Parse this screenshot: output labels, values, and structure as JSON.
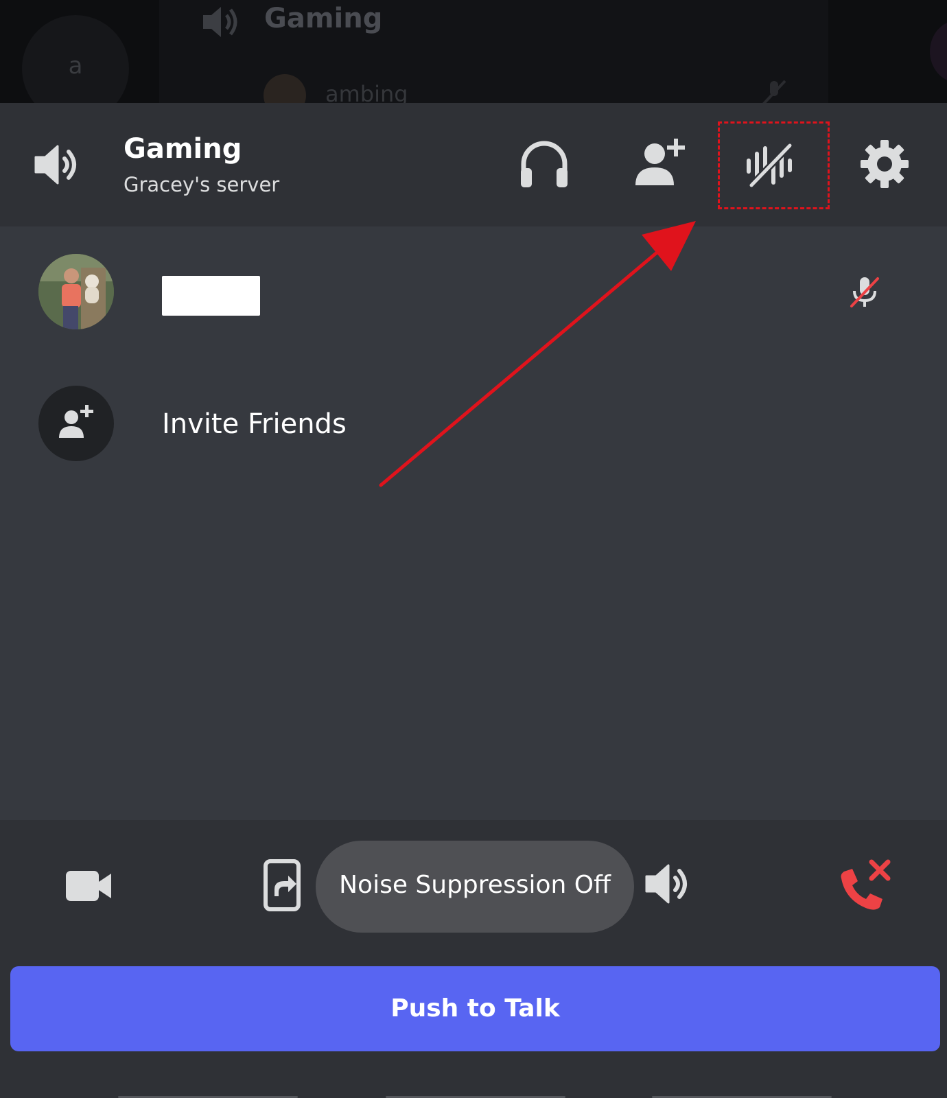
{
  "background": {
    "server_initial": "a",
    "channel_title": "Gaming",
    "user_name": "ambing"
  },
  "header": {
    "channel_title": "Gaming",
    "server_name": "Gracey's server",
    "icons": [
      "speaker-icon",
      "headphones-icon",
      "add-user-icon",
      "noise-suppression-icon",
      "gear-icon"
    ]
  },
  "members": {
    "invite_label": "Invite Friends"
  },
  "toast": {
    "text": "Noise Suppression Off"
  },
  "controls": {
    "icons": [
      "video-camera-icon",
      "screen-share-icon",
      "speaker-icon",
      "disconnect-icon"
    ],
    "push_to_talk_label": "Push to Talk"
  },
  "colors": {
    "accent": "#5865f2",
    "annotation": "#e0131c",
    "disconnect": "#ed4245",
    "muted_mic": "#ed4245"
  }
}
